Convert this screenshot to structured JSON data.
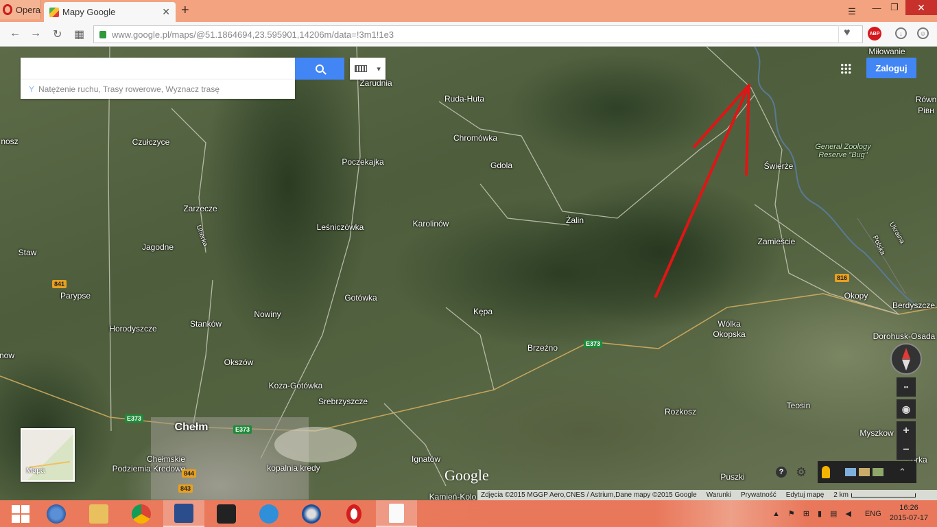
{
  "browser": {
    "menu_label": "Opera",
    "tab_title": "Mapy Google",
    "tab_close": "✕",
    "new_tab": "+",
    "win_menu": "☰",
    "win_min": "—",
    "win_max": "❐",
    "win_close": "✕"
  },
  "address": {
    "back": "←",
    "forward": "→",
    "reload": "↻",
    "speed_dial": "▦",
    "host": "www.google.pl",
    "path": "/maps/@51.1864694,23.595901,14206m/data=!3m1!1e3",
    "heart": "♥",
    "abp": "ABP",
    "download": "↓",
    "user": "☺"
  },
  "map": {
    "search_placeholder": "",
    "hint": "Natężenie ruchu, Trasy rowerowe, Wyznacz trasę",
    "login": "Zaloguj",
    "minimap_label": "Mapa",
    "logo": "Google",
    "help": "?",
    "gear": "⚙",
    "chevron": "⌃",
    "zoom_in": "+",
    "zoom_out": "−",
    "grid": "▪▪",
    "locate": "◉",
    "kbd_arrow": "▾",
    "attribution": "Zdjęcia ©2015 MGGP Aero,CNES / Astrium,Dane mapy ©2015 Google",
    "warunki": "Warunki",
    "privacy": "Prywatność",
    "edit": "Edytuj mapę",
    "scale": "2 km",
    "places": {
      "zarudnia": "Zarudnia",
      "ruda_huta": "Ruda-Huta",
      "milowanie": "Miłowanie",
      "rown": "Równ",
      "rivn": "Рівн",
      "nosz": "nosz",
      "czulczyce": "Czułczyce",
      "chromowka": "Chromówka",
      "poczekajka": "Poczekajka",
      "gdola": "Gdola",
      "gzr": "General Zoology",
      "gzr2": "Reserve \"Bug\"",
      "swierze": "Świerże",
      "zarzecze": "Zarzecze",
      "zalin": "Żalin",
      "lesniczowka": "Leśniczówka",
      "karolinow": "Karolinów",
      "uherka": "Uherka",
      "jagodne": "Jagodne",
      "zamiescie": "Zamieście",
      "staw": "Staw",
      "ukraina": "Ukraina",
      "polska": "Polska",
      "parypse": "Parypse",
      "gotowka": "Gotówka",
      "okopy": "Okopy",
      "berdyszcze": "Berdyszcze",
      "kepa": "Kępa",
      "nowiny": "Nowiny",
      "horodyszcze": "Horodyszcze",
      "stankow": "Stanków",
      "wolka1": "Wólka",
      "wolka2": "Okopska",
      "dorohusk": "Dorohusk-Osada",
      "brzezno": "Brzeźno",
      "now": "now",
      "okszow": "Okszów",
      "koza": "Koza-Gotówka",
      "srebrzyszcze": "Srebrzyszcze",
      "teosin": "Teosin",
      "chelm": "Chełm",
      "rozkosz": "Rozkosz",
      "myszkow": "Myszkow",
      "chelmskie1": "Chełmskie",
      "chelmskie2": "Podziemia Kredowe",
      "kopalnia": "kopalnia kredy",
      "ignatow": "Ignatów",
      "puszki": "Puszki",
      "kamien": "Kamień-Kolo",
      "gorka": "órka"
    },
    "shields": {
      "r841": "841",
      "e373a": "E373",
      "e373b": "E373",
      "e373c": "E373",
      "r816": "816",
      "r844": "844",
      "r843": "843"
    },
    "annotation_color": "#e01515"
  },
  "taskbar": {
    "tray_lang": "ENG",
    "time": "16:26",
    "date": "2015-07-17"
  }
}
